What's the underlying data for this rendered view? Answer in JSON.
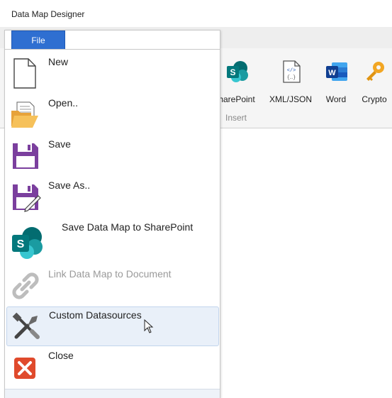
{
  "window": {
    "title": "Data Map Designer"
  },
  "file_tab": {
    "label": "File"
  },
  "ribbon": {
    "buttons": [
      {
        "label": "harePoint",
        "icon": "sharepoint-icon"
      },
      {
        "label": "XML/JSON",
        "icon": "xml-json-icon"
      },
      {
        "label": "Word",
        "icon": "word-icon"
      },
      {
        "label": "Crypto",
        "icon": "key-icon"
      }
    ],
    "group_label": "Insert"
  },
  "file_menu": {
    "items": [
      {
        "label": "New",
        "icon": "new-document-icon"
      },
      {
        "label": "Open..",
        "icon": "open-folder-icon"
      },
      {
        "label": "Save",
        "icon": "save-icon"
      },
      {
        "label": "Save As..",
        "icon": "save-as-icon"
      },
      {
        "label": "Save Data Map to SharePoint",
        "icon": "sharepoint-icon"
      },
      {
        "label": "Link Data Map to Document",
        "icon": "link-icon",
        "disabled": true
      },
      {
        "label": "Custom Datasources",
        "icon": "tools-icon",
        "hovered": true
      },
      {
        "label": "Close",
        "icon": "close-icon"
      }
    ]
  },
  "colors": {
    "file_tab": "#2f6fd1",
    "save_icon": "#7b3f9e",
    "close_icon": "#e04a2c",
    "sharepoint": "#078a8a",
    "word": "#2b5db4",
    "crypto_key": "#f2a623"
  }
}
